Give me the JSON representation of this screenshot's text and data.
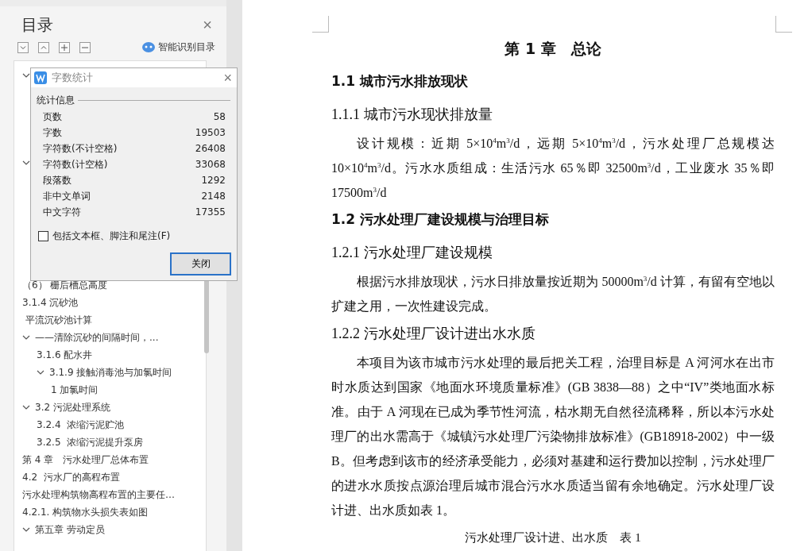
{
  "toc_panel": {
    "title": "目录",
    "close": "×",
    "smart_toc": "智能识别目录",
    "items": [
      {
        "expanded": true
      },
      {
        "expanded": true
      },
      {
        "text": "（6） 栅后槽总高度"
      },
      {
        "text": "3.1.4 沉砂池"
      },
      {
        "text": " 平流沉砂池计算"
      },
      {
        "text": "——清除沉砂的间隔时间，...",
        "expanded": true,
        "children": [
          {
            "text": "3.1.6 配水井"
          },
          {
            "text": "3.1.9 接触消毒池与加氯时间",
            "expanded": true,
            "children": [
              {
                "text": "1 加氯时间"
              }
            ]
          }
        ]
      },
      {
        "text": "3.2 污泥处理系统",
        "expanded": true,
        "children": [
          {
            "text": "3.2.4  浓缩污泥贮池"
          },
          {
            "text": "3.2.5  浓缩污泥提升泵房"
          }
        ]
      },
      {
        "text": "第 4 章　污水处理厂总体布置"
      },
      {
        "text": "4.2  污水厂的高程布置"
      },
      {
        "text": "污水处理构筑物高程布置的主要任…"
      },
      {
        "text": "4.2.1. 构筑物水头损失表如图"
      },
      {
        "text": "第五章 劳动定员",
        "expanded": true
      }
    ]
  },
  "dialog": {
    "title": "字数统计",
    "close": "×",
    "group": "统计信息",
    "stats": [
      {
        "label": "页数",
        "value": "58"
      },
      {
        "label": "字数",
        "value": "19503"
      },
      {
        "label": "字符数(不计空格)",
        "value": "26408"
      },
      {
        "label": "字符数(计空格)",
        "value": "33068"
      },
      {
        "label": "段落数",
        "value": "1292"
      },
      {
        "label": "非中文单词",
        "value": "2148"
      },
      {
        "label": "中文字符",
        "value": "17355"
      }
    ],
    "checkbox": {
      "label": "包括文本框、脚注和尾注(F)",
      "checked": false
    },
    "button": "关闭"
  },
  "document": {
    "blocks": [
      {
        "kind": "chapter",
        "text": "第 1 章　总论"
      },
      {
        "kind": "h2",
        "text": "1.1  城市污水排放现状"
      },
      {
        "kind": "h3",
        "text": "1.1.1 城市污水现状排放量"
      },
      {
        "kind": "p",
        "text": "设计规模：近期 5×10$^{4}$m$^{3}$/d，远期 5×10$^{4}$m$^{3}$/d，污水处理厂总规模达 10×10$^{4}$m$^{3}$/d。污水水质组成：生活污水 65％即 32500m$^{3}$/d，工业废水 35％即 17500m$^{3}$/d"
      },
      {
        "kind": "h2",
        "text": "1.2  污水处理厂建设规模与治理目标"
      },
      {
        "kind": "h3",
        "text": "1.2.1 污水处理厂建设规模"
      },
      {
        "kind": "p",
        "text": "根据污水排放现状，污水日排放量按近期为 50000m$^{3}$/d 计算，有留有空地以扩建之用，一次性建设完成。"
      },
      {
        "kind": "h3",
        "text": "1.2.2 污水处理厂设计进出水水质"
      },
      {
        "kind": "p",
        "text": "本项目为该市城市污水处理的最后把关工程，治理目标是 A 河河水在出市时水质达到国家《地面水环境质量标准》(GB 3838—88）之中“IV”类地面水标准。由于 A 河现在已成为季节性河流，枯水期无自然径流稀释，所以本污水处理厂的出水需高于《城镇污水处理厂污染物排放标准》(GB18918-2002）中一级 B。但考虑到该市的经济承受能力，必须对基建和运行费加以控制，污水处理厂的进水水质按点源治理后城市混合污水水质适当留有余地确定。污水处理厂设计进、出水质如表 1。"
      },
      {
        "kind": "caption",
        "text": "污水处理厂设计进、出水质　表 1"
      }
    ]
  }
}
